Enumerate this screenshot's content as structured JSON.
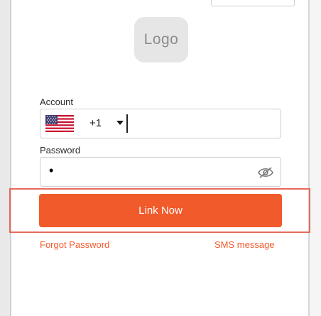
{
  "logo": {
    "text": "Logo"
  },
  "account": {
    "label": "Account",
    "country_icon": "us-flag-icon",
    "country_code": "+1",
    "value": ""
  },
  "password": {
    "label": "Password",
    "value": "•",
    "visibility_icon": "eye-off-icon"
  },
  "primary_button": {
    "label": "Link Now"
  },
  "links": {
    "forgot_password": "Forgot Password",
    "sms_message": "SMS message"
  },
  "colors": {
    "accent": "#f15a2b",
    "highlight_border": "#e66a5a",
    "logo_bg": "#e6e6e6"
  }
}
